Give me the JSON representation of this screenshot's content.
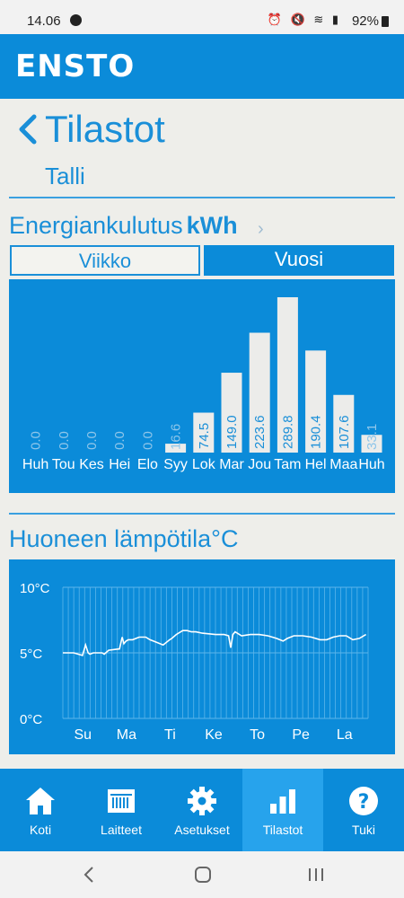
{
  "status": {
    "time": "14.06",
    "battery": "92%"
  },
  "brand": {
    "logo": "ENSTO"
  },
  "header": {
    "title": "Tilastot",
    "subtitle": "Talli"
  },
  "energy": {
    "title": "Energiankulutus",
    "unit": "kWh",
    "tabs": {
      "week": "Viikko",
      "year": "Vuosi"
    }
  },
  "temperature": {
    "title": "Huoneen lämpötila°C"
  },
  "chart_data": [
    {
      "type": "bar",
      "title": "Energiankulutus kWh",
      "categories": [
        "Huh",
        "Tou",
        "Kes",
        "Hei",
        "Elo",
        "Syy",
        "Lok",
        "Mar",
        "Jou",
        "Tam",
        "Hel",
        "Maa",
        "Huh"
      ],
      "values": [
        0.0,
        0.0,
        0.0,
        0.0,
        0.0,
        16.6,
        74.5,
        149.0,
        223.6,
        289.8,
        190.4,
        107.6,
        33.1
      ],
      "value_labels": [
        "0.0",
        "0.0",
        "0.0",
        "0.0",
        "0.0",
        "16.6",
        "74.5",
        "149.0",
        "223.6",
        "289.8",
        "190.4",
        "107.6",
        "33.1"
      ],
      "ylim": [
        0,
        289.8
      ],
      "colors": {
        "bar": "#ececea",
        "label_inside": "#1a8fd8",
        "label_outside": "#8fc6ea",
        "background": "#0b8bd9"
      }
    },
    {
      "type": "line",
      "title": "Huoneen lämpötila°C",
      "x_labels": [
        "Su",
        "Ma",
        "Ti",
        "Ke",
        "To",
        "Pe",
        "La"
      ],
      "y_ticks": [
        "10°C",
        "5°C",
        "0°C"
      ],
      "ylim": [
        0,
        10
      ],
      "series": [
        {
          "x": [
            0.0,
            0.25,
            0.45,
            0.52,
            0.58,
            0.62,
            0.7,
            0.9,
            0.95,
            1.05,
            1.3,
            1.36,
            1.4,
            1.45,
            1.5,
            1.6,
            1.75,
            1.9,
            2.0,
            2.15,
            2.3,
            2.45,
            2.5,
            2.6,
            2.75,
            2.85,
            2.95,
            3.05,
            3.2,
            3.5,
            3.7,
            3.8,
            3.85,
            3.9,
            3.95,
            4.1,
            4.3,
            4.5,
            4.7,
            4.9,
            5.05,
            5.15,
            5.3,
            5.5,
            5.7,
            5.9,
            6.05,
            6.2,
            6.35,
            6.5,
            6.65,
            6.8,
            6.95
          ],
          "y": [
            5.0,
            5.0,
            4.8,
            5.6,
            5.0,
            4.9,
            5.0,
            5.0,
            4.9,
            5.2,
            5.3,
            6.2,
            5.7,
            5.9,
            6.0,
            6.0,
            6.2,
            6.2,
            6.0,
            5.8,
            5.6,
            6.0,
            6.1,
            6.4,
            6.7,
            6.7,
            6.6,
            6.6,
            6.5,
            6.4,
            6.4,
            6.3,
            5.4,
            6.4,
            6.6,
            6.3,
            6.4,
            6.4,
            6.3,
            6.1,
            5.9,
            6.1,
            6.3,
            6.3,
            6.2,
            6.0,
            6.0,
            6.2,
            6.3,
            6.3,
            6.0,
            6.1,
            6.4
          ],
          "color": "#ffffff"
        }
      ],
      "grid": true,
      "colors": {
        "background": "#0b8bd9",
        "grid": "#5cb5ea",
        "line": "#ffffff",
        "text": "#ffffff"
      }
    }
  ],
  "bottom_nav": [
    {
      "label": "Koti",
      "icon": "home-icon"
    },
    {
      "label": "Laitteet",
      "icon": "devices-icon"
    },
    {
      "label": "Asetukset",
      "icon": "gear-icon"
    },
    {
      "label": "Tilastot",
      "icon": "bar-chart-icon",
      "active": true
    },
    {
      "label": "Tuki",
      "icon": "help-icon"
    }
  ],
  "android_nav": {
    "back": "back-icon",
    "home": "home-circle-icon",
    "recents": "recents-icon"
  }
}
